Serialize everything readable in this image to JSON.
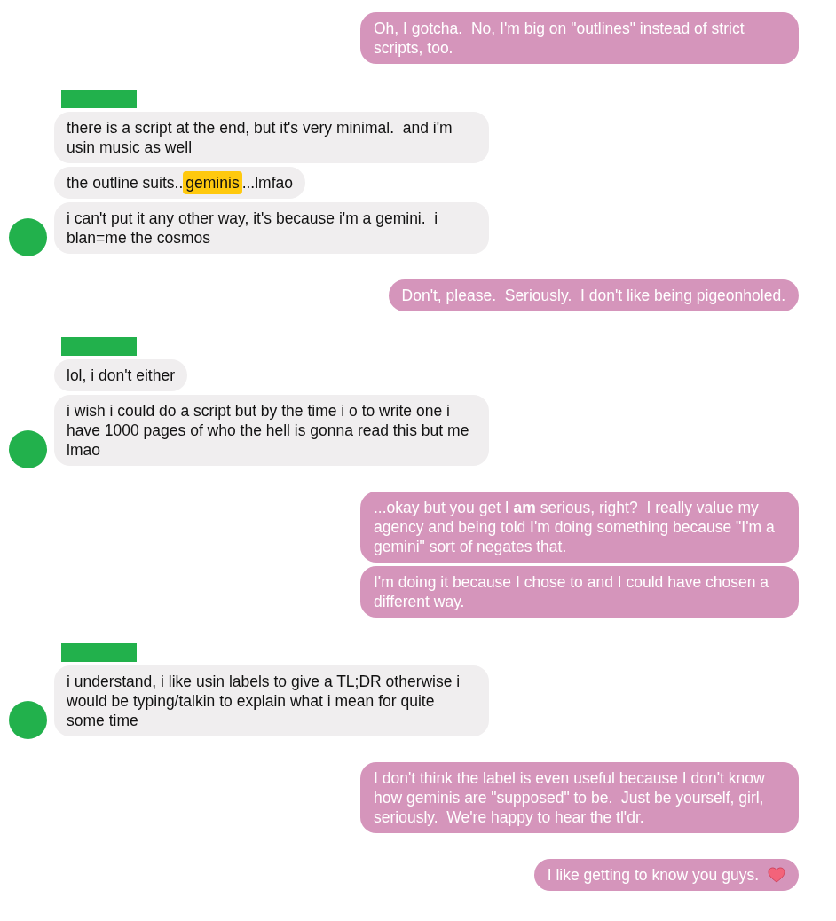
{
  "messages": [
    {
      "kind": "outgoing",
      "bubbles": [
        {
          "kind": "plain",
          "text": "Oh, I gotcha.  No, I'm big on \"outlines\" instead of strict scripts, too."
        }
      ]
    },
    {
      "kind": "incoming",
      "bubbles": [
        {
          "kind": "plain",
          "text": "there is a script at the end, but it's very minimal.  and i'm usin music as well"
        },
        {
          "kind": "segmented",
          "segments": [
            {
              "text": "the outline suits..",
              "highlighted": false
            },
            {
              "text": "geminis",
              "highlighted": true
            },
            {
              "text": "...lmfao",
              "highlighted": false
            }
          ]
        },
        {
          "kind": "plain",
          "text": "i can't put it any other way, it's because i'm a gemini.  i blan=me the cosmos"
        }
      ]
    },
    {
      "kind": "outgoing",
      "bubbles": [
        {
          "kind": "plain",
          "text": "Don't, please.  Seriously.  I don't like being pigeonholed."
        }
      ]
    },
    {
      "kind": "incoming",
      "bubbles": [
        {
          "kind": "plain",
          "text": "lol, i don't either"
        },
        {
          "kind": "plain",
          "text": "i wish i could do a script but by the time i o to write one i have 1000 pages of who the hell is gonna read this but me lmao"
        }
      ]
    },
    {
      "kind": "outgoing",
      "bubbles": [
        {
          "kind": "plain",
          "text": "...okay but you get I **am** serious, right?  I really value my agency and being told I'm doing something because \"I'm a gemini\" sort of negates that."
        },
        {
          "kind": "plain",
          "text": "I'm doing it because I chose to and I could have chosen a different way."
        }
      ]
    },
    {
      "kind": "incoming",
      "bubbles": [
        {
          "kind": "plain",
          "text": "i understand, i like usin labels to give a TL;DR otherwise i would be typing/talkin to explain what i mean for quite some time"
        }
      ]
    },
    {
      "kind": "outgoing",
      "bubbles": [
        {
          "kind": "plain",
          "text": "I don't think the label is even useful because I don't know how geminis are \"supposed\" to be.  Just be yourself, girl, seriously.  We're happy to hear the tl'dr."
        }
      ]
    },
    {
      "kind": "outgoing",
      "bubbles": [
        {
          "kind": "heart",
          "text": "I like getting to know you guys."
        }
      ]
    }
  ]
}
